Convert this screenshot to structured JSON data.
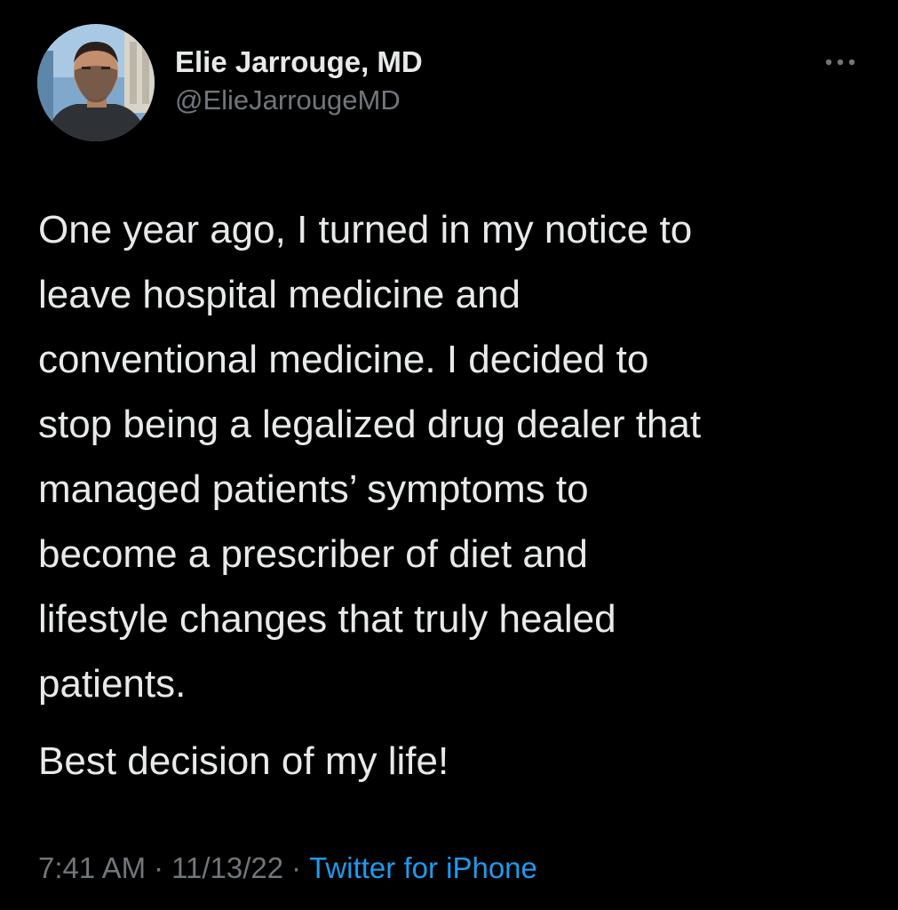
{
  "author": {
    "display_name": "Elie Jarrouge, MD",
    "handle": "@ElieJarrougeMD",
    "avatar_icon": "profile-photo"
  },
  "more_icon": "ellipsis-icon",
  "tweet": {
    "lines": [
      "One year ago, I turned in my notice to",
      "leave hospital medicine and",
      "conventional medicine. I decided to",
      "stop being a legalized drug dealer that",
      "managed patients’ symptoms to",
      "become a prescriber of diet and",
      "lifestyle changes that truly healed",
      "patients."
    ],
    "closing": "Best decision of my life!"
  },
  "meta": {
    "time": "7:41 AM",
    "separator": "·",
    "date": "11/13/22",
    "source": "Twitter for iPhone"
  },
  "colors": {
    "background": "#000000",
    "text": "#e7e9ea",
    "secondary": "#71767b",
    "link": "#1d9bf0"
  }
}
